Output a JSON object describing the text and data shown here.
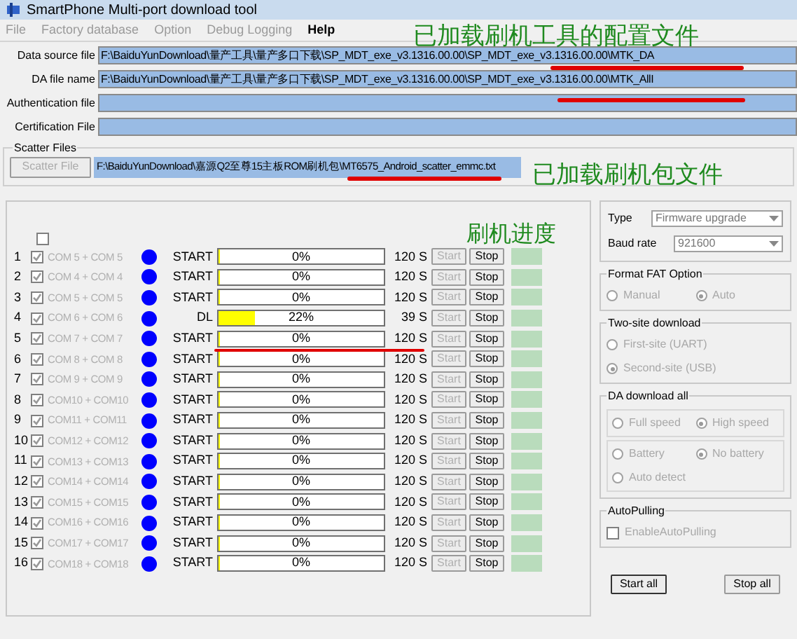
{
  "window": {
    "title": "SmartPhone Multi-port download tool"
  },
  "menu": [
    {
      "label": "File",
      "disabled": true
    },
    {
      "label": "Factory database",
      "disabled": true
    },
    {
      "label": "Option",
      "disabled": true
    },
    {
      "label": "Debug Logging",
      "disabled": true
    },
    {
      "label": "Help",
      "disabled": false
    }
  ],
  "files": [
    {
      "label": "Data source file",
      "value": "F:\\BaiduYunDownload\\量产工具\\量产多口下载\\SP_MDT_exe_v3.1316.00.00\\SP_MDT_exe_v3.1316.00.00\\MTK_DA"
    },
    {
      "label": "DA file name",
      "value": "F:\\BaiduYunDownload\\量产工具\\量产多口下载\\SP_MDT_exe_v3.1316.00.00\\SP_MDT_exe_v3.1316.00.00\\MTK_AllI"
    },
    {
      "label": "Authentication file"
    },
    {
      "label": "Certification File"
    }
  ],
  "scatter": {
    "group": "Scatter Files",
    "button": "Scatter File",
    "value": "F:\\BaiduYunDownload\\嘉源Q2至尊15主板ROM刷机包\\MT6575_Android_scatter_emmc.txt"
  },
  "annotations": [
    "已加载刷机工具的配置文件",
    "已加载刷机包文件",
    "刷机进度"
  ],
  "select_all": {
    "checked": false
  },
  "ports": [
    {
      "num": "1",
      "checked": true,
      "port": "COM 5 + COM 5",
      "color": "#0000ff",
      "status": "START",
      "progress": "0%",
      "level": 0,
      "time": "120 S",
      "start": "Start",
      "stop": "Stop"
    },
    {
      "num": "2",
      "checked": true,
      "port": "COM 4 + COM 4",
      "color": "#0000ff",
      "status": "START",
      "progress": "0%",
      "level": 0,
      "time": "120 S",
      "start": "Start",
      "stop": "Stop"
    },
    {
      "num": "3",
      "checked": true,
      "port": "COM 5 + COM 5",
      "color": "#0000ff",
      "status": "START",
      "progress": "0%",
      "level": 0,
      "time": "120 S",
      "start": "Start",
      "stop": "Stop"
    },
    {
      "num": "4",
      "checked": true,
      "port": "COM 6 + COM 6",
      "color": "#0000ff",
      "status": "DL",
      "progress": "22%",
      "level": 0.22,
      "time": "39 S",
      "start": "Start",
      "stop": "Stop"
    },
    {
      "num": "5",
      "checked": true,
      "port": "COM 7 + COM 7",
      "color": "#0000ff",
      "status": "START",
      "progress": "0%",
      "level": 0,
      "time": "120 S",
      "start": "Start",
      "stop": "Stop"
    },
    {
      "num": "6",
      "checked": true,
      "port": "COM 8 + COM 8",
      "color": "#0000ff",
      "status": "START",
      "progress": "0%",
      "level": 0,
      "time": "120 S",
      "start": "Start",
      "stop": "Stop"
    },
    {
      "num": "7",
      "checked": true,
      "port": "COM 9 + COM 9",
      "color": "#0000ff",
      "status": "START",
      "progress": "0%",
      "level": 0,
      "time": "120 S",
      "start": "Start",
      "stop": "Stop"
    },
    {
      "num": "8",
      "checked": true,
      "port": "COM10 + COM10",
      "color": "#0000ff",
      "status": "START",
      "progress": "0%",
      "level": 0,
      "time": "120 S",
      "start": "Start",
      "stop": "Stop"
    },
    {
      "num": "9",
      "checked": true,
      "port": "COM11 + COM11",
      "color": "#0000ff",
      "status": "START",
      "progress": "0%",
      "level": 0,
      "time": "120 S",
      "start": "Start",
      "stop": "Stop"
    },
    {
      "num": "10",
      "checked": true,
      "port": "COM12 + COM12",
      "color": "#0000ff",
      "status": "START",
      "progress": "0%",
      "level": 0,
      "time": "120 S",
      "start": "Start",
      "stop": "Stop"
    },
    {
      "num": "11",
      "checked": true,
      "port": "COM13 + COM13",
      "color": "#0000ff",
      "status": "START",
      "progress": "0%",
      "level": 0,
      "time": "120 S",
      "start": "Start",
      "stop": "Stop"
    },
    {
      "num": "12",
      "checked": true,
      "port": "COM14 + COM14",
      "color": "#0000ff",
      "status": "START",
      "progress": "0%",
      "level": 0,
      "time": "120 S",
      "start": "Start",
      "stop": "Stop"
    },
    {
      "num": "13",
      "checked": true,
      "port": "COM15 + COM15",
      "color": "#0000ff",
      "status": "START",
      "progress": "0%",
      "level": 0,
      "time": "120 S",
      "start": "Start",
      "stop": "Stop"
    },
    {
      "num": "14",
      "checked": true,
      "port": "COM16 + COM16",
      "color": "#0000ff",
      "status": "START",
      "progress": "0%",
      "level": 0,
      "time": "120 S",
      "start": "Start",
      "stop": "Stop"
    },
    {
      "num": "15",
      "checked": true,
      "port": "COM17 + COM17",
      "color": "#0000ff",
      "status": "START",
      "progress": "0%",
      "level": 0,
      "time": "120 S",
      "start": "Start",
      "stop": "Stop"
    },
    {
      "num": "16",
      "checked": true,
      "port": "COM18 + COM18",
      "color": "#0000ff",
      "status": "START",
      "progress": "0%",
      "level": 0,
      "time": "120 S",
      "start": "Start",
      "stop": "Stop"
    }
  ],
  "settings": {
    "type_label": "Type",
    "type_value": "Firmware upgrade",
    "baud_label": "Baud rate",
    "baud_value": "921600"
  },
  "groups": [
    {
      "title": "Format FAT Option",
      "sections": [
        [
          {
            "kind": "radio",
            "label": "Manual",
            "selected": false
          },
          {
            "kind": "radio",
            "label": "Auto",
            "selected": true
          }
        ]
      ]
    },
    {
      "title": "Two-site download",
      "sections": [
        [
          {
            "kind": "radio",
            "label": "First-site (UART)",
            "selected": false
          },
          {
            "kind": "radio",
            "label": "Second-site (USB)",
            "selected": true
          }
        ]
      ]
    },
    {
      "title": "DA download all",
      "sections": [
        [
          {
            "kind": "radio",
            "label": "Full speed",
            "selected": false
          },
          {
            "kind": "radio",
            "label": "High speed",
            "selected": true
          }
        ],
        [
          {
            "kind": "radio",
            "label": "Battery",
            "selected": false
          },
          {
            "kind": "radio",
            "label": "No battery",
            "selected": true
          },
          {
            "kind": "radio",
            "label": "Auto detect",
            "selected": false
          }
        ]
      ]
    },
    {
      "title": "AutoPulling",
      "sections": [
        [
          {
            "kind": "checkbox",
            "label": "EnableAutoPulling",
            "checked": false
          }
        ]
      ]
    }
  ],
  "buttons": [
    "Start all",
    "Stop all"
  ]
}
